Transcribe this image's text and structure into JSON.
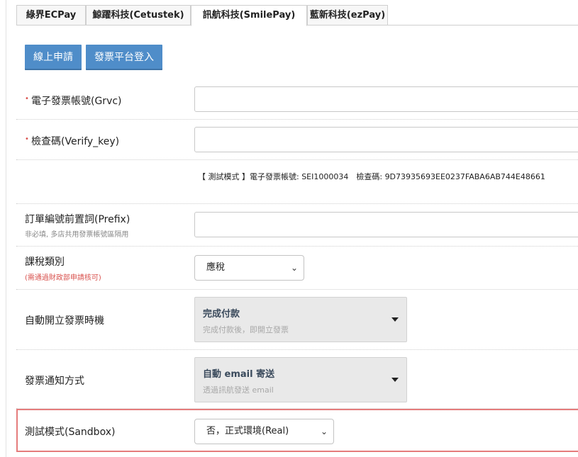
{
  "tabs": [
    {
      "label": "綠界ECPay"
    },
    {
      "label": "鯨躍科技(Cetustek)"
    },
    {
      "label": "訊航科技(SmilePay)"
    },
    {
      "label": "藍新科技(ezPay)"
    }
  ],
  "buttons": {
    "apply": "線上申請",
    "login": "發票平台登入"
  },
  "form": {
    "grvc": {
      "required_mark": "•",
      "label": "電子發票帳號(Grvc)",
      "value": ""
    },
    "verify_key": {
      "required_mark": "•",
      "label": "檢查碼(Verify_key)",
      "value": ""
    },
    "test_info": "【 測試模式 】電子發票帳號: SEI1000034　檢查碼: 9D73935693EE0237FABA6AB744E48661",
    "prefix": {
      "label": "訂單編號前置詞(Prefix)",
      "hint": "非必填, 多店共用發票帳號區隔用",
      "value": ""
    },
    "tax_type": {
      "label": "課稅類別",
      "hint": "(需通過財政部申請核可)",
      "selected": "應稅"
    },
    "issue_timing": {
      "label": "自動開立發票時機",
      "selected": "完成付款",
      "description": "完成付款後，即開立發票"
    },
    "notify": {
      "label": "發票通知方式",
      "selected": "自動 email 寄送",
      "description": "透過訊航發送 email"
    },
    "sandbox": {
      "label": "測試模式(Sandbox)",
      "selected": "否，正式環境(Real)"
    }
  },
  "colors": {
    "button_bg": "#4f8dc9",
    "required": "#d9534f",
    "highlight_border": "#e57c7c"
  }
}
